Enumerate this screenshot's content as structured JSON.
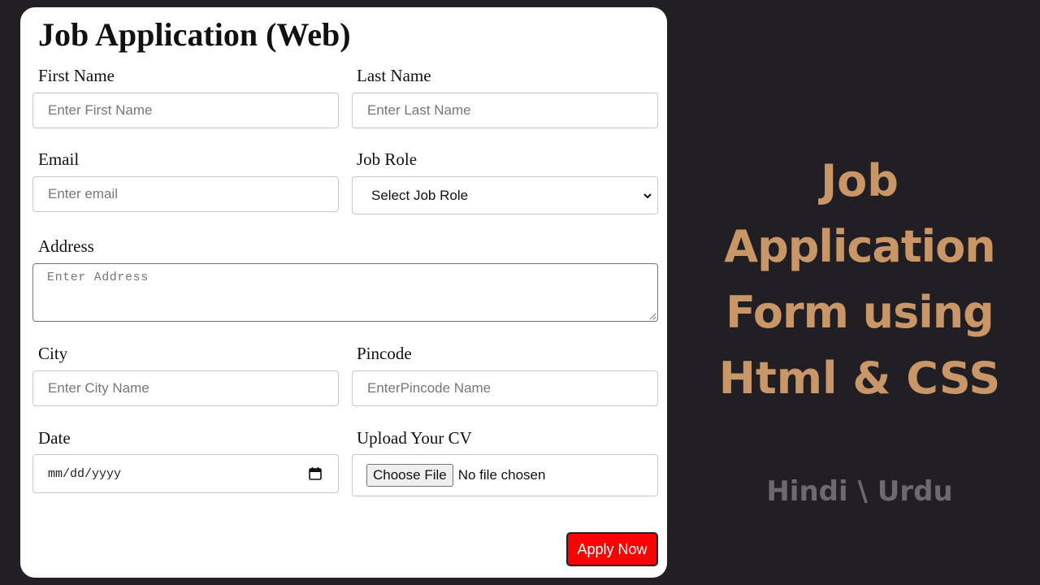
{
  "form": {
    "title": "Job Application (Web)",
    "first_name": {
      "label": "First Name",
      "placeholder": "Enter First Name"
    },
    "last_name": {
      "label": "Last Name",
      "placeholder": "Enter Last Name"
    },
    "email": {
      "label": "Email",
      "placeholder": "Enter email"
    },
    "job_role": {
      "label": "Job Role",
      "selected": "Select Job Role"
    },
    "address": {
      "label": "Address",
      "placeholder": "Enter Address"
    },
    "city": {
      "label": "City",
      "placeholder": "Enter City Name"
    },
    "pincode": {
      "label": "Pincode",
      "placeholder": "EnterPincode Name"
    },
    "date": {
      "label": "Date",
      "value": "mm/dd/yyyy"
    },
    "cv": {
      "label": "Upload Your CV",
      "button_label": "Choose File",
      "status": "No file chosen"
    },
    "apply_label": "Apply Now"
  },
  "promo": {
    "lines": [
      "Job",
      "Application",
      "Form using",
      "Html & CSS"
    ],
    "subtitle": "Hindi \\ Urdu"
  },
  "colors": {
    "background": "#221f24",
    "card": "#ffffff",
    "promo_text": "#c99667",
    "subtitle_text": "#6c6a6e",
    "apply_button": "#ff0000"
  },
  "icons": {
    "select": "chevron-down-icon",
    "date": "calendar-icon",
    "textarea": "resize-grip-icon"
  }
}
